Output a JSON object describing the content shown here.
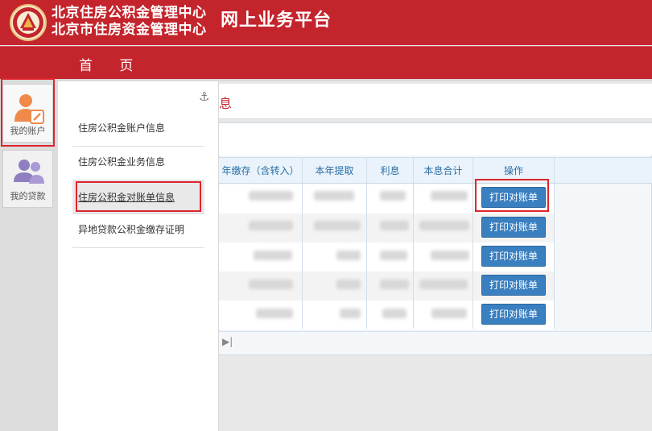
{
  "header": {
    "org_line1": "北京住房公积金管理中心",
    "org_line2": "北京市住房资金管理中心",
    "platform_title": "网上业务平台",
    "brand_color": "#c4242c"
  },
  "nav": {
    "home_label": "首 页"
  },
  "sidebar": {
    "tabs": [
      {
        "label": "我的账户",
        "icon": "user-edit-icon",
        "active": true
      },
      {
        "label": "我的贷款",
        "icon": "users-icon",
        "active": false
      }
    ]
  },
  "submenu": {
    "pin_icon": "anchor-icon",
    "items": [
      {
        "label": "住房公积金账户信息"
      },
      {
        "label": "住房公积金业务信息"
      },
      {
        "label": "住房公积金对账单信息",
        "active": true
      },
      {
        "label": "异地贷款公积金缴存证明"
      }
    ]
  },
  "content": {
    "breadcrumb_fragment": "息",
    "table": {
      "headers": [
        "年缴存（含转入）",
        "本年提取",
        "利息",
        "本息合计",
        "操作"
      ],
      "rows": [
        {
          "action": "打印对账单"
        },
        {
          "action": "打印对账单"
        },
        {
          "action": "打印对账单"
        },
        {
          "action": "打印对账单"
        },
        {
          "action": "打印对账单"
        }
      ]
    },
    "pager_last_icon": "last-page-icon"
  },
  "highlight_color": "#e0242c"
}
